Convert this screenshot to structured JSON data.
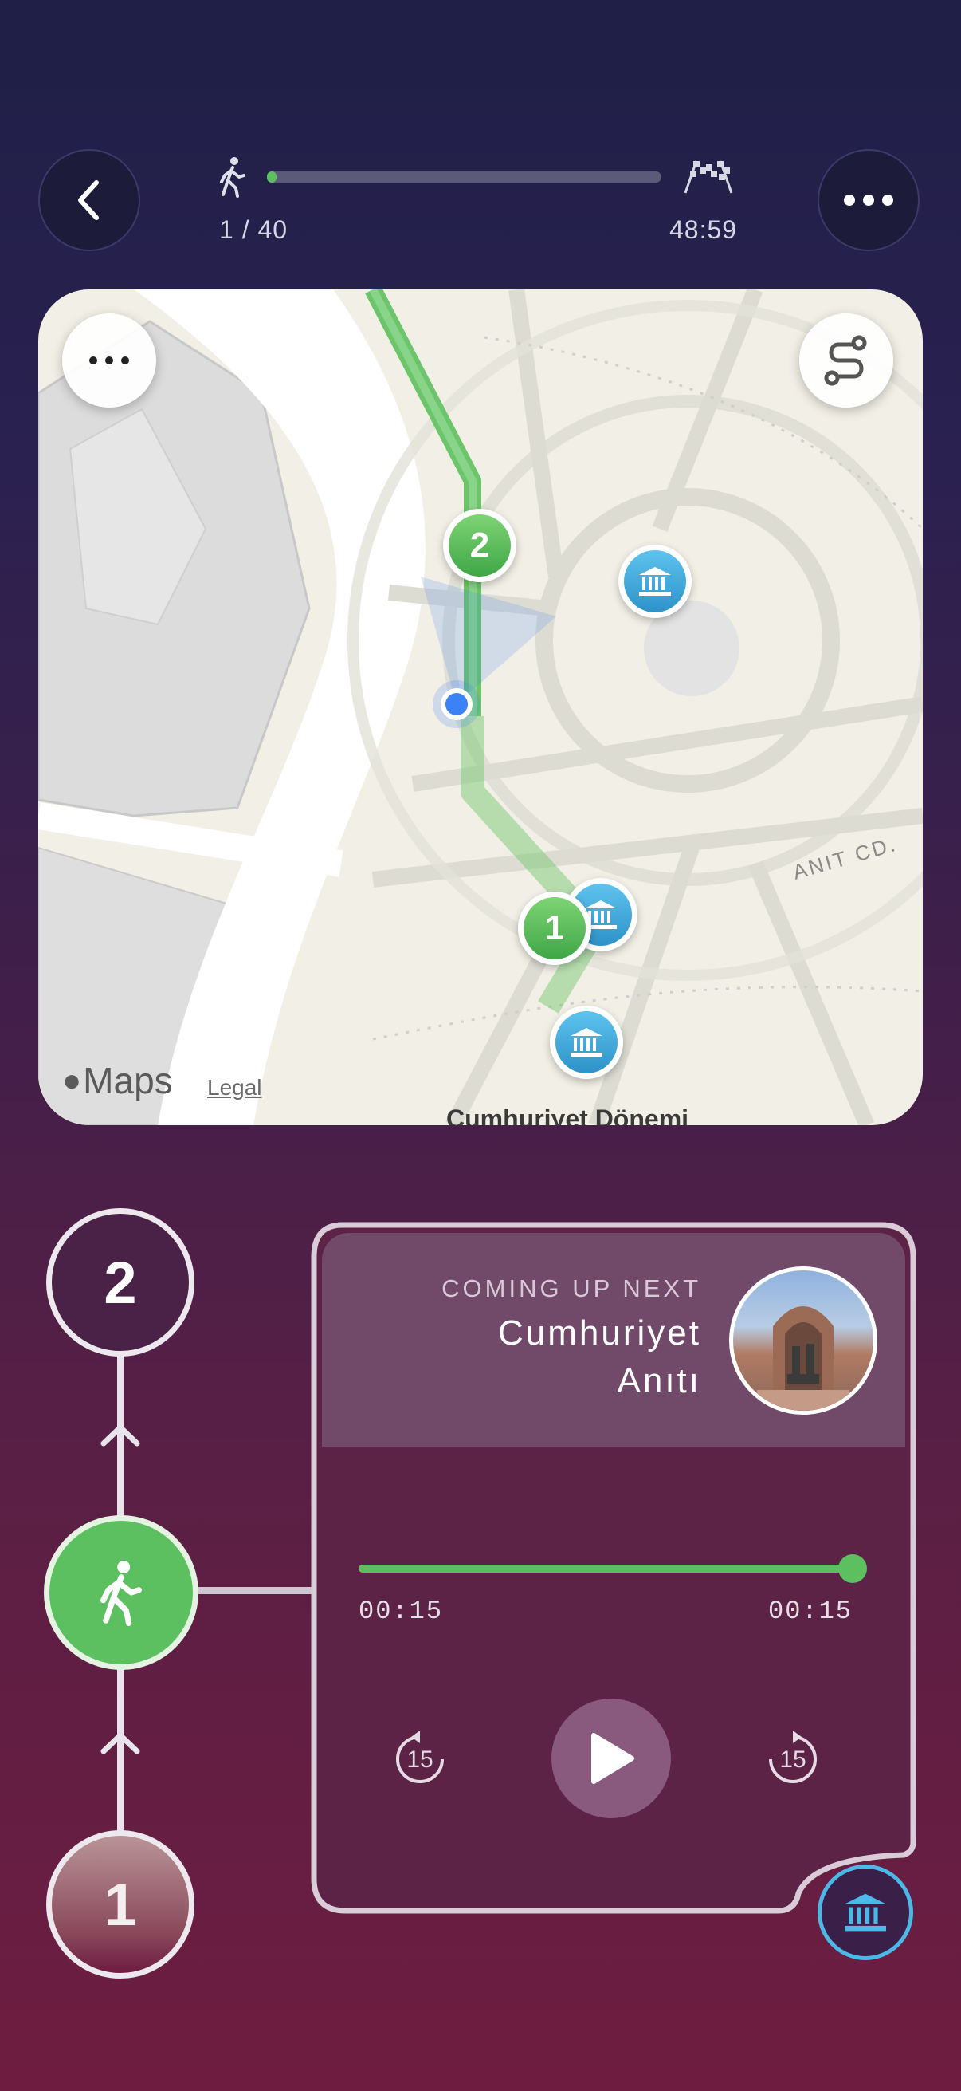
{
  "header": {
    "progress_label": "1 / 40",
    "remaining_time": "48:59",
    "progress_fraction": 0.02,
    "start_icon": "walking-person-icon",
    "finish_icon": "checkered-flags-icon"
  },
  "map": {
    "attribution": "Maps",
    "legal": "Legal",
    "street_label": "ANIT CD.",
    "place_label": "Cumhuriyet Dönemi",
    "markers": [
      {
        "label": "2",
        "type": "route-stop"
      },
      {
        "label": "1",
        "type": "route-stop"
      }
    ],
    "colors": {
      "route": "#6cc56a",
      "poi": "#3ea6d8",
      "user": "#3b82f6"
    }
  },
  "steps": {
    "next": "2",
    "previous": "1"
  },
  "player": {
    "coming_up_label": "COMING UP NEXT",
    "title_line1": "Cumhuriyet",
    "title_line2": "Anıtı",
    "elapsed": "00:15",
    "duration": "00:15",
    "progress_fraction": 1.0,
    "skip_back": "15",
    "skip_forward": "15",
    "accent": "#5cc060"
  }
}
